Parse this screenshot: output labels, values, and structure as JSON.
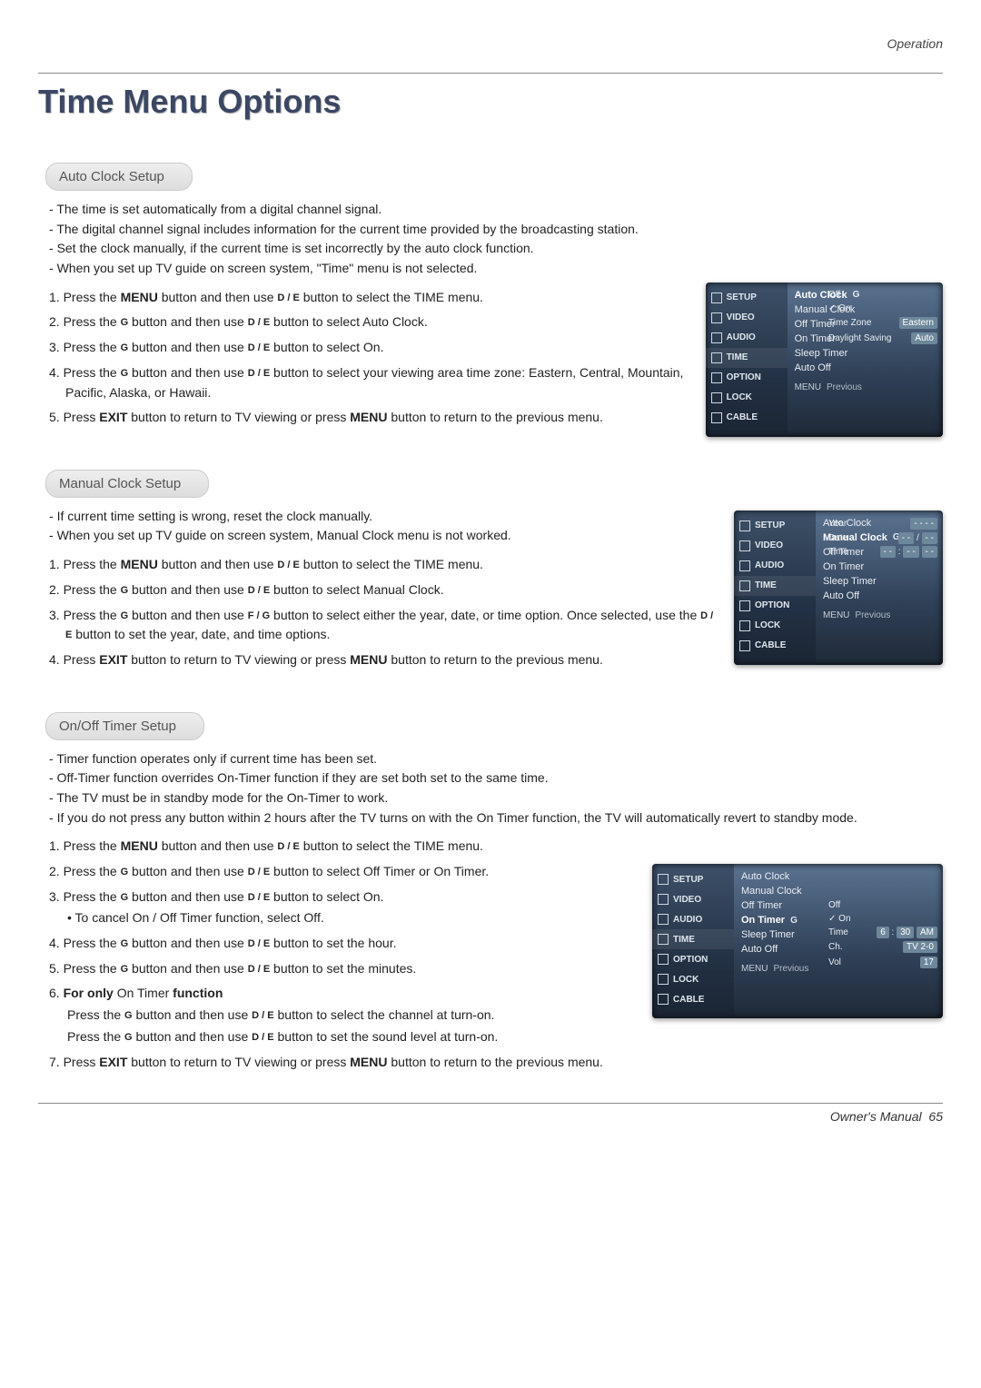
{
  "header": {
    "section_label": "Operation",
    "title": "Time Menu Options"
  },
  "footer": {
    "label": "Owner's Manual",
    "page": "65"
  },
  "osd_nav": [
    "SETUP",
    "VIDEO",
    "AUDIO",
    "TIME",
    "OPTION",
    "LOCK",
    "CABLE"
  ],
  "osd_foot": {
    "menu": "MENU",
    "prev": "Previous"
  },
  "auto": {
    "pill": "Auto Clock Setup",
    "intro": [
      "The time is set automatically from a digital channel signal.",
      "The digital channel signal includes information for the current time provided by the broadcasting station.",
      "Set the clock manually, if the current time is set incorrectly by the auto clock function.",
      "When you set up TV guide on screen system, \"Time\" menu is not selected."
    ],
    "s1a": "1.  Press the ",
    "s1b": "MENU",
    "s1c": " button and then use ",
    "s1d": " button to select the ",
    "s1e": "TIME",
    "s1f": " menu.",
    "s2a": "2.  Press the ",
    "s2b": " button and then use ",
    "s2c": " button to select ",
    "s2d": "Auto Clock",
    "s2e": ".",
    "s3a": "3.  Press the ",
    "s3b": " button and then use ",
    "s3c": " button to select ",
    "s3d": "On",
    "s3e": ".",
    "s4a": "4.  Press the ",
    "s4b": " button and then use ",
    "s4c": " button to select your viewing area time zone: ",
    "s4d": "Eastern",
    "s4e": ", ",
    "s4f": "Central",
    "s4g": ", ",
    "s4h": "Mountain",
    "s4i": ", ",
    "s4j": "Pacific",
    "s4k": ", ",
    "s4l": "Alaska",
    "s4m": ", or ",
    "s4n": "Hawaii",
    "s4o": ".",
    "s5a": "5.  Press ",
    "s5b": "EXIT",
    "s5c": " button to return to TV viewing or press ",
    "s5d": "MENU",
    "s5e": " button to return to the previous menu.",
    "osd": {
      "items": [
        "Auto Clock",
        "Manual Clock",
        "Off Timer",
        "On Timer",
        "Sleep Timer",
        "Auto Off"
      ],
      "hl": "Auto Clock",
      "off": "Off",
      "on": "On",
      "tz_label": "Time Zone",
      "tz_val": "Eastern",
      "dst_label": "Daylight Saving",
      "dst_val": "Auto"
    }
  },
  "manual": {
    "pill": "Manual Clock Setup",
    "intro": [
      "If current time setting is wrong, reset the clock manually.",
      "When you set up TV guide on screen system, Manual Clock menu is not worked."
    ],
    "s1a": "1.  Press the ",
    "s1b": "MENU",
    "s1c": " button and then use ",
    "s1d": " button to select the ",
    "s1e": "TIME",
    "s1f": " menu.",
    "s2a": "2.  Press the ",
    "s2b": " button and then use ",
    "s2c": " button to select ",
    "s2d": "Manual Clock",
    "s2e": ".",
    "s3a": "3.  Press the ",
    "s3b": " button and then use ",
    "s3c": " button to select either the year, date, or time option. Once selected, use the ",
    "s3d": " button to set the year, date, and time options.",
    "s4a": "4.  Press ",
    "s4b": "EXIT",
    "s4c": " button to return to TV viewing or press ",
    "s4d": "MENU",
    "s4e": " button to return to the previous menu.",
    "osd": {
      "items": [
        "Auto Clock",
        "Manual Clock",
        "Off Timer",
        "On Timer",
        "Sleep Timer",
        "Auto Off"
      ],
      "hl": "Manual Clock",
      "year_l": "Year",
      "year_v": "- - - -",
      "date_l": "Date",
      "date_v1": "- -",
      "date_s": "/",
      "date_v2": "- -",
      "time_l": "Time",
      "time_v1": "- -",
      "time_s": ":",
      "time_v2": "- -",
      "time_v3": "- -"
    }
  },
  "onoff": {
    "pill": "On/Off Timer Setup",
    "intro": [
      "Timer function operates only if current time has been set.",
      "Off-Timer function overrides On-Timer function if they are set both set to the same time.",
      "The TV must be in standby mode for the On-Timer to work.",
      "If you do not press any button within 2 hours after the TV turns on with the On Timer function, the TV will automatically revert to standby mode."
    ],
    "s1a": "1.  Press the ",
    "s1b": "MENU",
    "s1c": " button and then use ",
    "s1d": " button to select the ",
    "s1e": "TIME",
    "s1f": " menu.",
    "s2a": "2.  Press the ",
    "s2b": " button and then use ",
    "s2c": " button to select ",
    "s2d": "Off Timer",
    "s2e": " or ",
    "s2f": "On Timer",
    "s2g": ".",
    "s3a": "3.  Press the ",
    "s3b": " button and then use ",
    "s3c": " button to select ",
    "s3d": "On",
    "s3e": ".",
    "s3sub_a": "• To cancel ",
    "s3sub_b": "On",
    "s3sub_c": " / ",
    "s3sub_d": "Off Timer",
    "s3sub_e": " function, select ",
    "s3sub_f": "Off",
    "s3sub_g": ".",
    "s4a": "4.  Press the ",
    "s4b": " button and then use ",
    "s4c": " button to set the hour.",
    "s5a": "5.  Press the ",
    "s5b": " button and then use ",
    "s5c": " button to set the minutes.",
    "s6a": "6.  ",
    "s6b": "For only ",
    "s6c": "On Timer",
    "s6d": " function",
    "s6l1a": "Press the ",
    "s6l1b": " button and then use ",
    "s6l1c": " button to select the channel at turn-on.",
    "s6l2a": "Press the ",
    "s6l2b": " button and then use ",
    "s6l2c": " button to set the sound level at turn-on.",
    "s7a": "7.  Press ",
    "s7b": "EXIT",
    "s7c": " button to return to TV viewing or press ",
    "s7d": "MENU",
    "s7e": " button to return to the previous menu.",
    "osd": {
      "items": [
        "Auto Clock",
        "Manual Clock",
        "Off Timer",
        "On Timer",
        "Sleep Timer",
        "Auto Off"
      ],
      "hl": "On Timer",
      "off": "Off",
      "on": "On",
      "time_l": "Time",
      "time_h": "6",
      "time_s": ":",
      "time_m": "30",
      "time_ap": "AM",
      "ch_l": "Ch.",
      "ch_v": "TV  2-0",
      "vol_l": "Vol",
      "vol_v": "17"
    }
  },
  "dir": {
    "de": "D / E",
    "fg": "F / G",
    "g": "G"
  }
}
